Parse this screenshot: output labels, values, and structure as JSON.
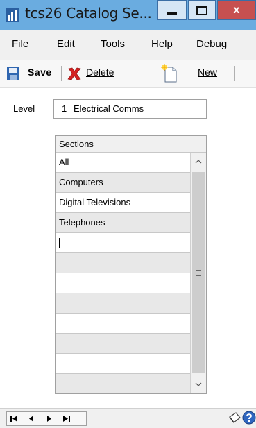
{
  "window": {
    "title": "tcs26 Catalog Se...",
    "close_glyph": "x",
    "colors": {
      "titlebar": "#6aace0",
      "close": "#c75050"
    }
  },
  "menu": {
    "items": [
      "File",
      "Edit",
      "Tools",
      "Help",
      "Debug"
    ]
  },
  "toolbar": {
    "save_label": "Save",
    "delete_label": "Delete",
    "new_label": "New",
    "icons": {
      "save": "save-disk-icon",
      "delete": "red-x-icon",
      "new": "new-document-icon"
    }
  },
  "level": {
    "label": "Level",
    "number": "1",
    "name": "Electrical Comms"
  },
  "sections": {
    "header": "Sections",
    "rows": [
      "All",
      "Computers",
      "Digital Televisions",
      "Telephones",
      "",
      "",
      "",
      "",
      "",
      "",
      "",
      ""
    ]
  },
  "bottom": {
    "nav": [
      "first",
      "previous",
      "next",
      "last"
    ],
    "icons": {
      "note": "note-icon",
      "help": "help-icon"
    }
  }
}
